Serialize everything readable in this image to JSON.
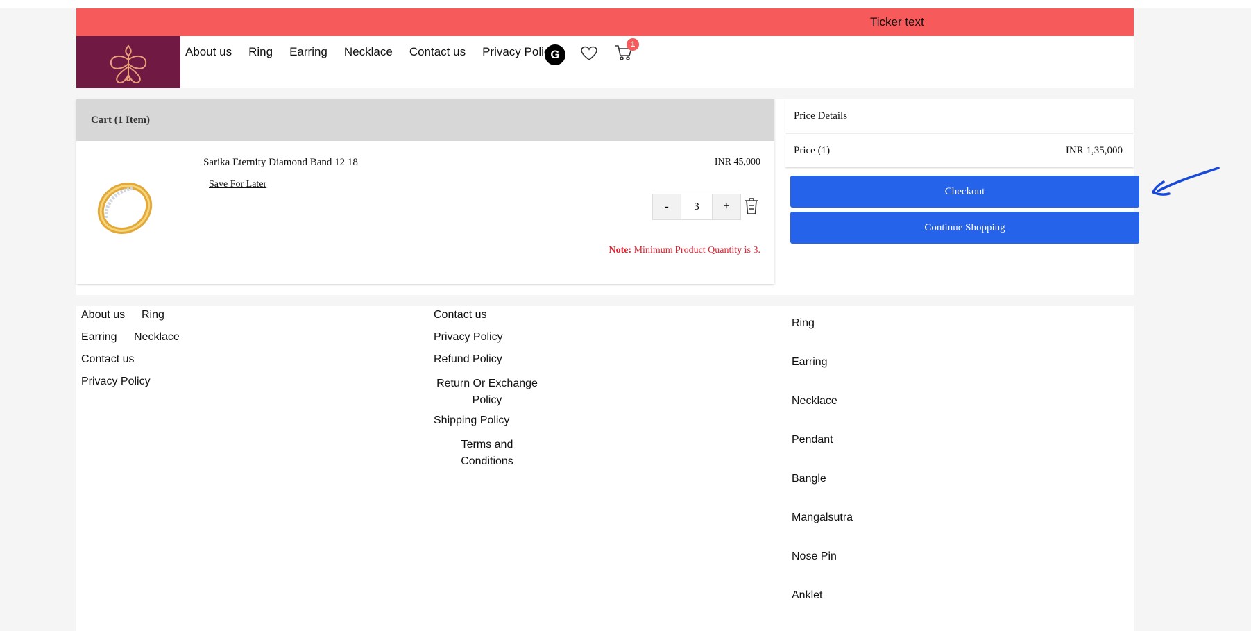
{
  "ticker": {
    "text": "Ticker text"
  },
  "nav": {
    "items": [
      "About us",
      "Ring",
      "Earring",
      "Necklace",
      "Contact us",
      "Privacy Policy"
    ],
    "account_initial": "G",
    "cart_count": "1"
  },
  "cart": {
    "title": "Cart (1 Item)",
    "item": {
      "name": "Sarika Eternity Diamond Band 12 18",
      "price": "INR 45,000",
      "save_label": "Save For Later",
      "qty_minus": "-",
      "qty_value": "3",
      "qty_plus": "+",
      "note_label": "Note:",
      "note_text": " Minimum Product Quantity is 3."
    }
  },
  "price_details": {
    "title": "Price Details",
    "row_label": "Price (1)",
    "row_value": "INR 1,35,000"
  },
  "buttons": {
    "checkout": "Checkout",
    "continue": "Continue Shopping"
  },
  "footer": {
    "col1": [
      "About us",
      "Ring",
      "Earring",
      "Necklace",
      "Contact us",
      "Privacy Policy"
    ],
    "col2": [
      "Contact us",
      "Privacy Policy",
      "Refund Policy",
      "Return Or Exchange Policy",
      "Shipping Policy",
      "Terms and Conditions"
    ],
    "col3": [
      "Ring",
      "Earring",
      "Necklace",
      "Pendant",
      "Bangle",
      "Mangalsutra",
      "Nose Pin",
      "Anklet"
    ]
  },
  "colors": {
    "ticker": "#f65a5b",
    "logo_bg": "#701a43",
    "button": "#2563eb",
    "note": "#e0202e"
  },
  "icons": [
    "logo-ornament-icon",
    "heart-icon",
    "cart-icon",
    "trash-icon",
    "arrow-icon"
  ]
}
